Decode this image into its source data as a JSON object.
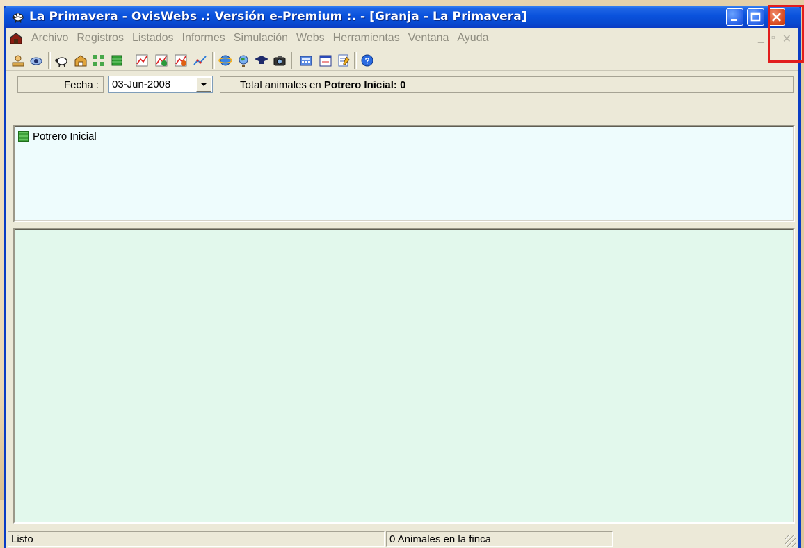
{
  "window": {
    "title": "La Primavera - OvisWebs .: Versión e-Premium :. - [Granja - La Primavera]"
  },
  "menubar": {
    "items": [
      "Archivo",
      "Registros",
      "Listados",
      "Informes",
      "Simulación",
      "Webs",
      "Herramientas",
      "Ventana",
      "Ayuda"
    ],
    "mdi_controls": [
      "_",
      "▫",
      "✕"
    ]
  },
  "toolbar": {
    "icons": [
      "edit-icon",
      "view-icon",
      "sheep-icon",
      "barn-icon",
      "herd-icon",
      "paddock-icon",
      "chart-icon",
      "chart-add-icon",
      "chart-remove-icon",
      "trend-icon",
      "internet-icon",
      "globe-icon",
      "graduate-icon",
      "camera-icon",
      "calculator-icon",
      "calendar-icon",
      "notes-icon",
      "help-icon"
    ]
  },
  "datebar": {
    "fecha_label": "Fecha :",
    "date_value": "03-Jun-2008",
    "total_prefix": "Total animales en",
    "total_bold": "Potrero Inicial: 0"
  },
  "tree": {
    "items": [
      {
        "label": "Potrero Inicial"
      }
    ]
  },
  "statusbar": {
    "status": "Listo",
    "animals": "0 Animales en la finca",
    "extra": ""
  },
  "colors": {
    "titlebar": "#0a52dc",
    "pane_top_bg": "#eefcfd",
    "pane_bottom_bg": "#e2f8ec",
    "highlight_box": "#e21d1d"
  }
}
